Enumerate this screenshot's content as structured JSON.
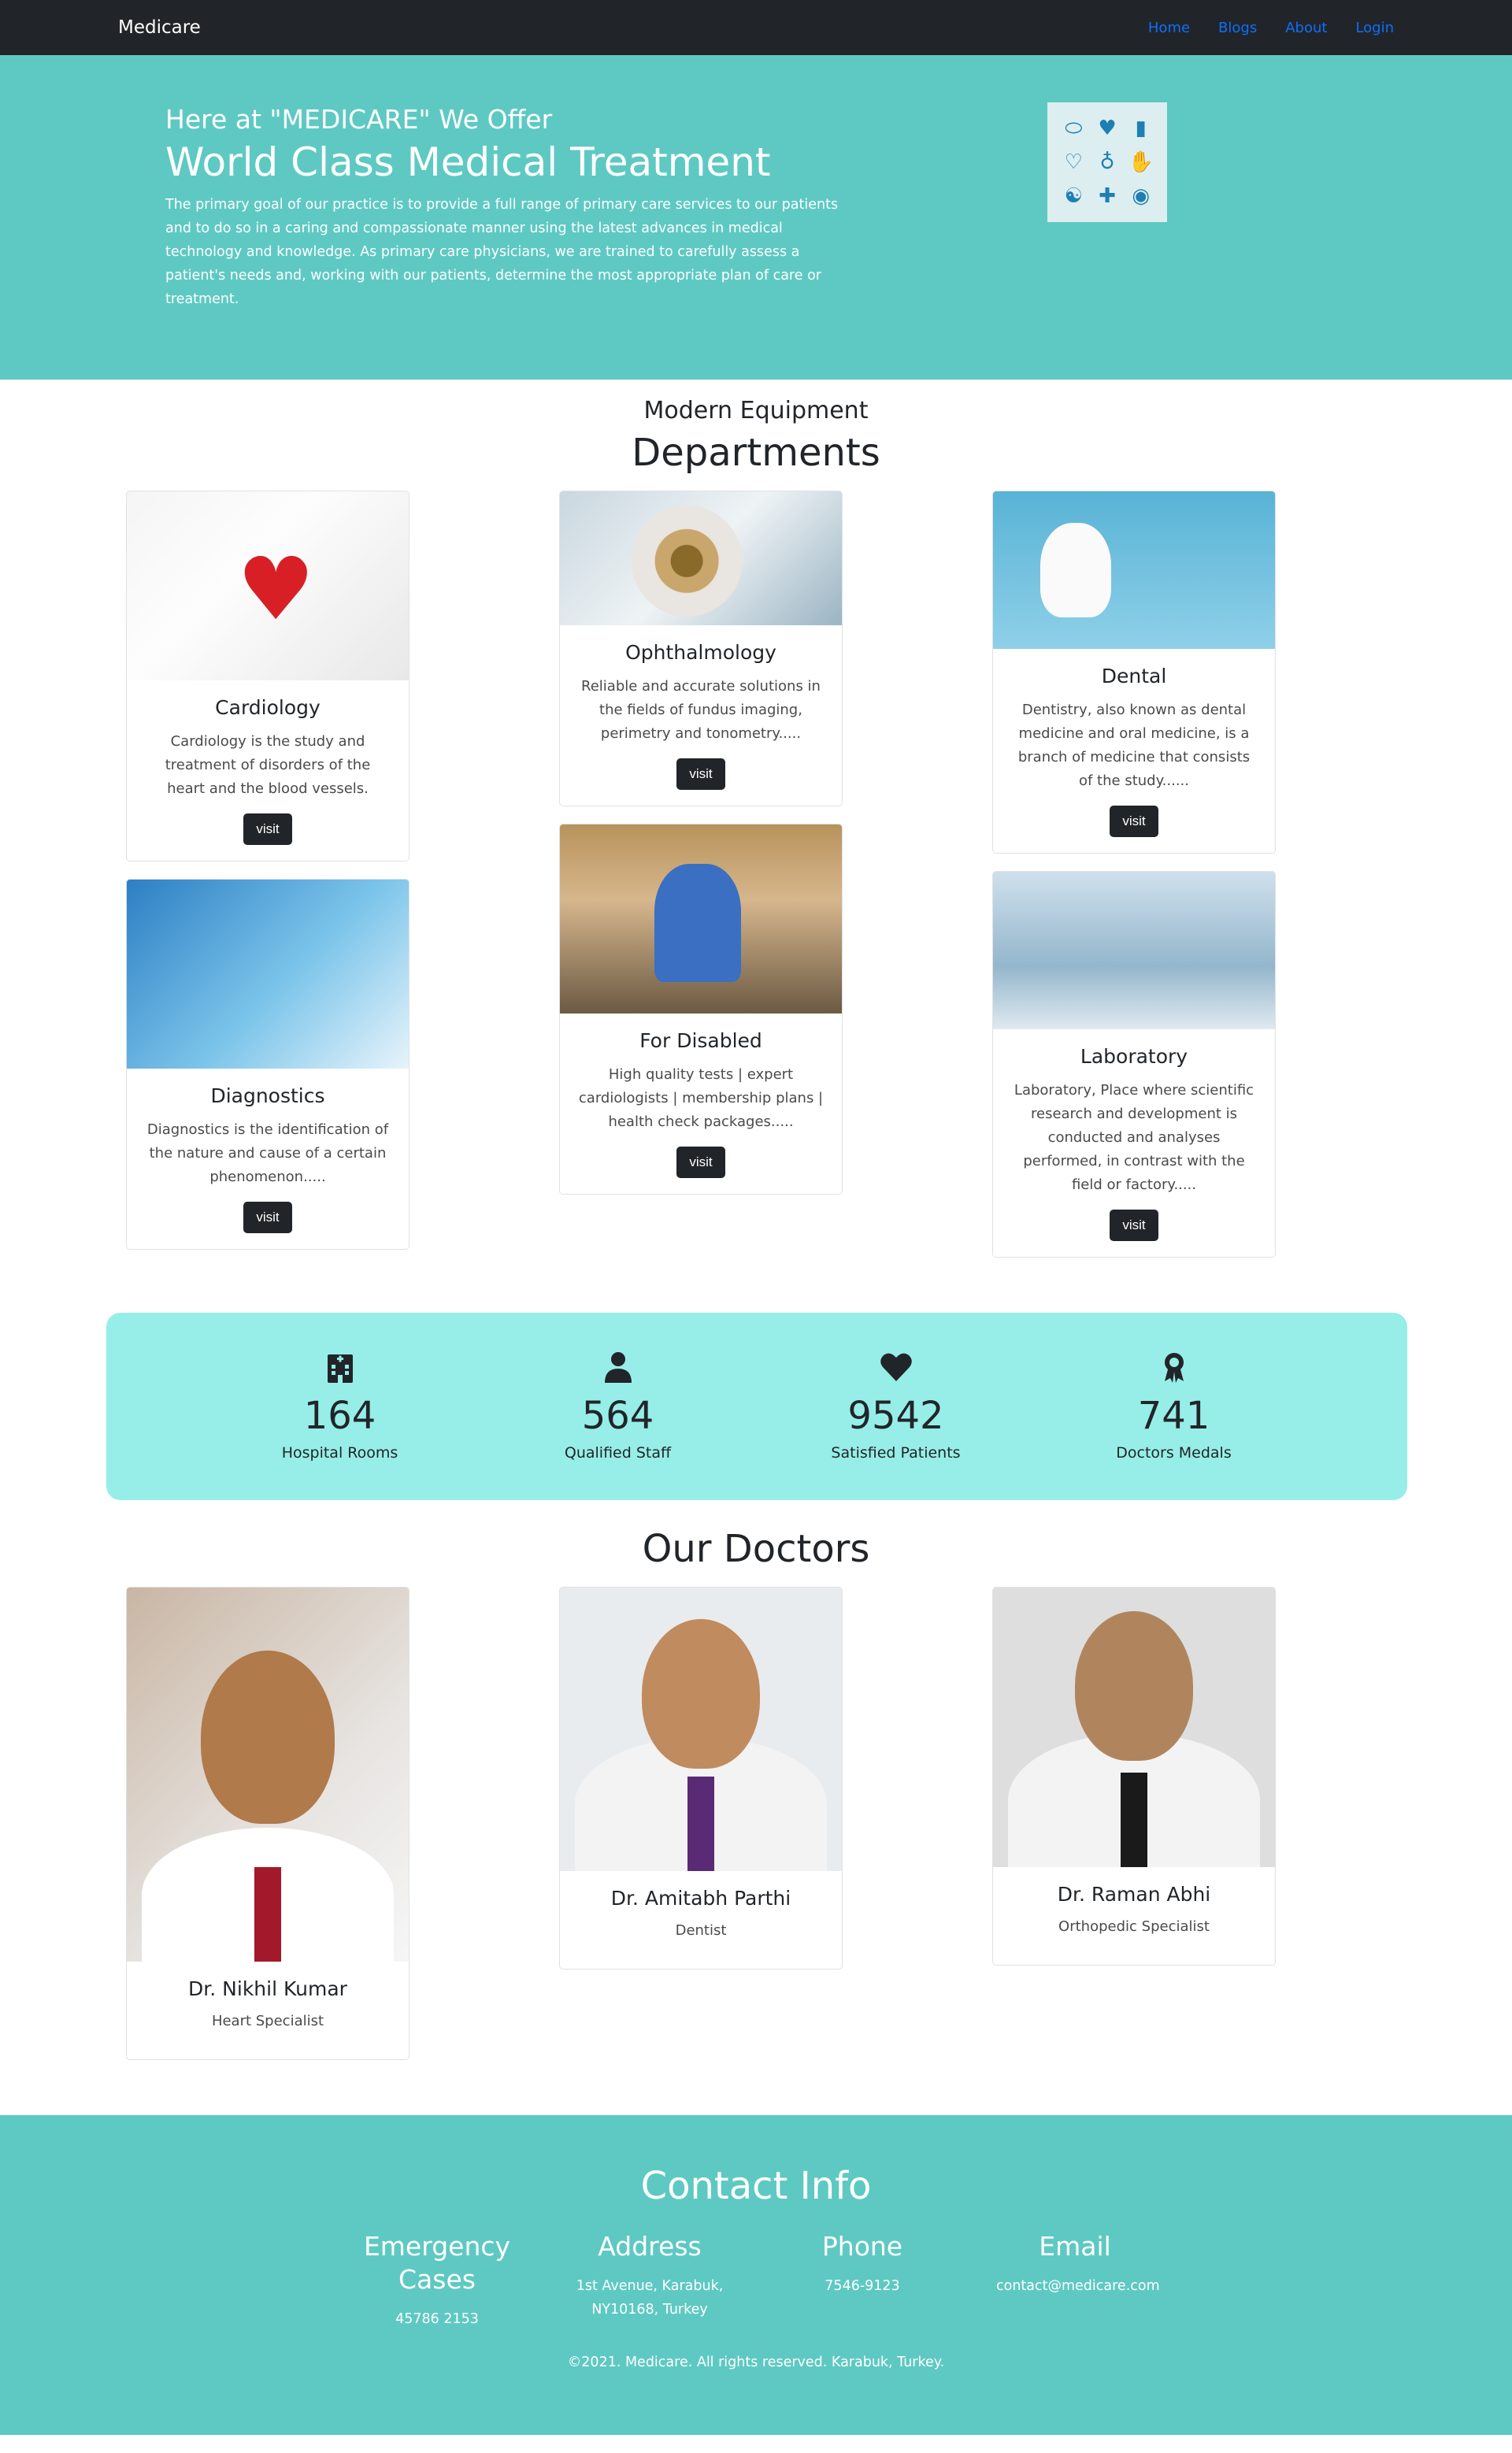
{
  "nav": {
    "brand": "Medicare",
    "links": [
      "Home",
      "Blogs",
      "About",
      "Login"
    ]
  },
  "hero": {
    "subtitle": "Here at \"MEDICARE\" We Offer",
    "title": "World Class Medical Treatment",
    "description": "The primary goal of our practice is to provide a full range of primary care services to our patients and to do so in a caring and compassionate manner using the latest advances in medical technology and knowledge. As primary care physicians, we are trained to carefully assess a patient's needs and, working with our patients, determine the most appropriate plan of care or treatment."
  },
  "departments": {
    "eyebrow": "Modern Equipment",
    "title": "Departments",
    "button_label": "visit",
    "items": [
      {
        "title": "Cardiology",
        "text": "Cardiology is the study and treatment of disorders of the heart and the blood vessels."
      },
      {
        "title": "Ophthalmology",
        "text": "Reliable and accurate solutions in the fields of fundus imaging, perimetry and tonometry....."
      },
      {
        "title": "Dental",
        "text": "Dentistry, also known as dental medicine and oral medicine, is a branch of medicine that consists of the study......"
      },
      {
        "title": "Diagnostics",
        "text": "Diagnostics is the identification of the nature and cause of a certain phenomenon....."
      },
      {
        "title": "For Disabled",
        "text": "High quality tests | expert cardiologists | membership plans | health check packages....."
      },
      {
        "title": "Laboratory",
        "text": "Laboratory, Place where scientific research and development is conducted and analyses performed, in contrast with the field or factory....."
      }
    ]
  },
  "stats": [
    {
      "icon": "hospital-icon",
      "value": "164",
      "label": "Hospital Rooms"
    },
    {
      "icon": "person-icon",
      "value": "564",
      "label": "Qualified Staff"
    },
    {
      "icon": "heart-icon",
      "value": "9542",
      "label": "Satisfied Patients"
    },
    {
      "icon": "award-icon",
      "value": "741",
      "label": "Doctors Medals"
    }
  ],
  "doctors": {
    "title": "Our Doctors",
    "items": [
      {
        "name": "Dr. Nikhil Kumar",
        "role": "Heart Specialist"
      },
      {
        "name": "Dr. Amitabh Parthi",
        "role": "Dentist"
      },
      {
        "name": "Dr. Raman Abhi",
        "role": "Orthopedic Specialist"
      }
    ]
  },
  "contact": {
    "title": "Contact Info",
    "items": [
      {
        "heading": "Emergency Cases",
        "value": "45786 2153"
      },
      {
        "heading": "Address",
        "value": "1st Avenue, Karabuk, NY10168, Turkey"
      },
      {
        "heading": "Phone",
        "value": "7546-9123"
      },
      {
        "heading": "Email",
        "value": "contact@medicare.com"
      }
    ],
    "copyright": "©2021. Medicare. All rights reserved. Karabuk, Turkey."
  },
  "colors": {
    "navbar": "#212529",
    "hero_bg": "#5ec9c2",
    "stats_bg": "#97eee8",
    "link": "#0d6efd",
    "button": "#212529"
  }
}
